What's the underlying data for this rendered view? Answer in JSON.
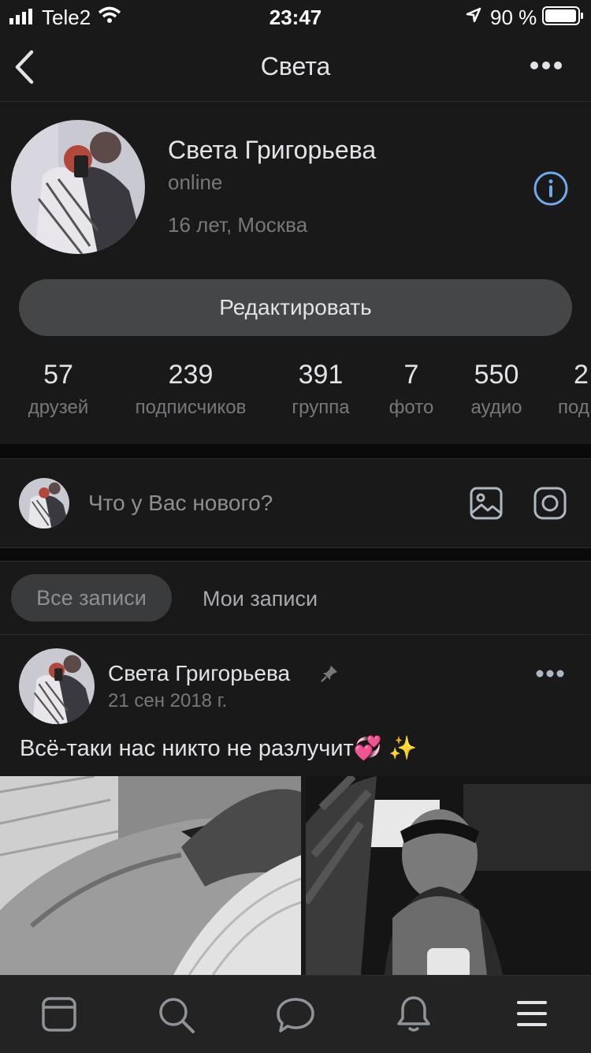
{
  "status_bar": {
    "carrier": "Tele2",
    "time": "23:47",
    "battery": "90 %"
  },
  "nav": {
    "title": "Света"
  },
  "profile": {
    "name": "Света Григорьева",
    "status": "online",
    "info": "16 лет, Москва",
    "edit_label": "Редактировать"
  },
  "stats": [
    {
      "num": "57",
      "label": "друзей"
    },
    {
      "num": "239",
      "label": "подписчиков"
    },
    {
      "num": "391",
      "label": "группа"
    },
    {
      "num": "7",
      "label": "фото"
    },
    {
      "num": "550",
      "label": "аудио"
    },
    {
      "num": "2",
      "label": "под"
    }
  ],
  "composer": {
    "placeholder": "Что у Вас нового?"
  },
  "tabs": {
    "all": "Все записи",
    "mine": "Мои записи"
  },
  "post": {
    "author": "Света Григорьева",
    "date": "21 сен 2018 г.",
    "text": "Всё-таки нас никто не разлучит💞 ✨"
  },
  "colors": {
    "background": "#19191a",
    "accent": "#71aaeb",
    "button": "#454647"
  }
}
